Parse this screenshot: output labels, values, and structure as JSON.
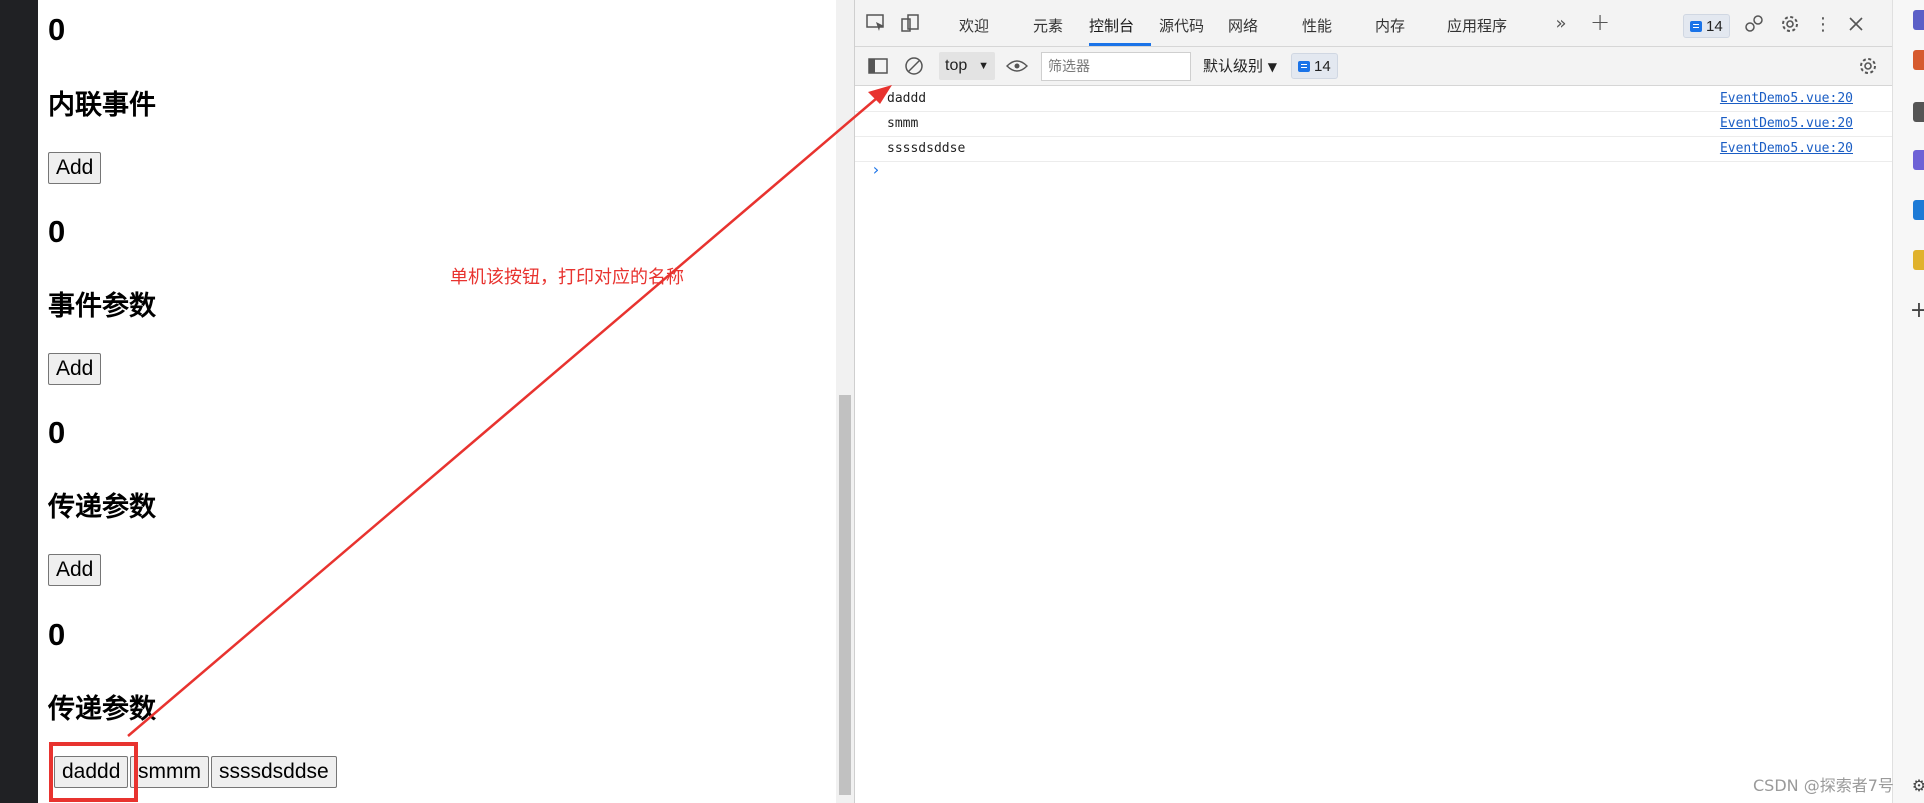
{
  "page": {
    "sections": [
      {
        "count": "0",
        "title": "内联事件",
        "button": "Add"
      },
      {
        "count": "0",
        "title": "事件参数",
        "button": "Add"
      },
      {
        "count": "0",
        "title": "传递参数",
        "button": "Add"
      },
      {
        "count": "0",
        "title": "传递参数",
        "buttons": [
          "daddd",
          "smmm",
          "ssssdsddse"
        ]
      }
    ]
  },
  "devtools": {
    "tabs": [
      "欢迎",
      "元素",
      "控制台",
      "源代码",
      "网络",
      "性能",
      "内存",
      "应用程序"
    ],
    "active_tab": "控制台",
    "issues_count": "14",
    "toolbar": {
      "context": "top",
      "filter_placeholder": "筛选器",
      "level": "默认级别",
      "badge_count": "14"
    },
    "console_logs": [
      {
        "text": "daddd",
        "source": "EventDemo5.vue:20"
      },
      {
        "text": "smmm",
        "source": "EventDemo5.vue:20"
      },
      {
        "text": "ssssdsddse",
        "source": "EventDemo5.vue:20"
      }
    ]
  },
  "annotation": {
    "text": "单机该按钮，打印对应的名称",
    "color": "#e8332f"
  },
  "watermark": "CSDN @探索者7号",
  "colors": {
    "accent": "#1a73e8",
    "annotation": "#e8332f",
    "link": "#1a5dc4"
  }
}
